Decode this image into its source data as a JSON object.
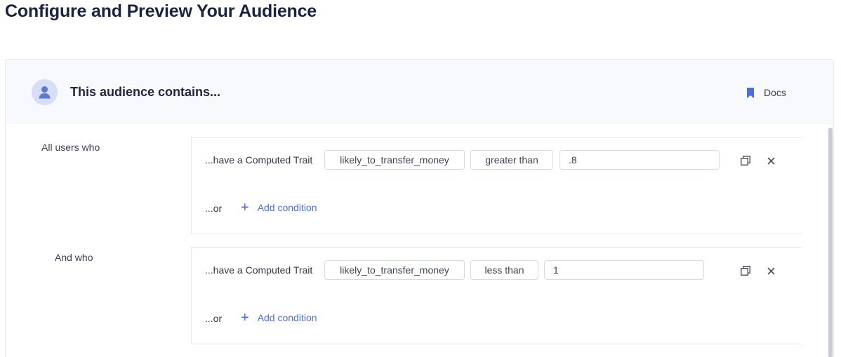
{
  "page": {
    "title": "Configure and Preview Your Audience"
  },
  "header": {
    "title": "This audience contains...",
    "docs_label": "Docs"
  },
  "groups": [
    {
      "label": "All users who",
      "condition": {
        "prefix": "...have a Computed Trait",
        "trait": "likely_to_transfer_money",
        "operator": "greater than",
        "value": ".8"
      },
      "or_label": "...or",
      "add_icon": "plus-icon",
      "add_label": "Add condition"
    },
    {
      "label": "And who",
      "condition": {
        "prefix": "...have a Computed Trait",
        "trait": "likely_to_transfer_money",
        "operator": "less than",
        "value": "1"
      },
      "or_label": "...or",
      "add_icon": "plus-icon",
      "add_label": "Add condition"
    }
  ],
  "icons": {
    "avatar": "user-icon",
    "docs": "bookmark-icon",
    "duplicate": "duplicate-icon",
    "remove": "close-icon"
  },
  "colors": {
    "accent": "#4a6ee0",
    "title": "#1c2340",
    "header_bg": "#f8f9fc",
    "avatar_bg": "#d6def8"
  }
}
